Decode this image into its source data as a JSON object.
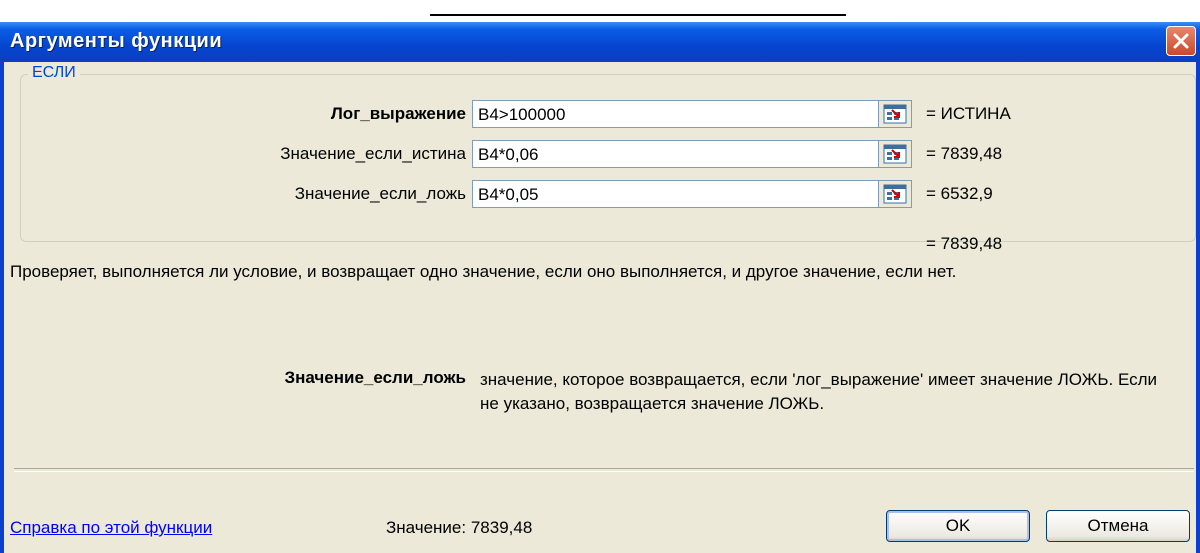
{
  "window": {
    "title": "Аргументы функции"
  },
  "function_group": {
    "name": "ЕСЛИ"
  },
  "arguments": [
    {
      "label": "Лог_выражение",
      "value": "B4>100000",
      "result": "= ИСТИНА",
      "bold": true
    },
    {
      "label": "Значение_если_истина",
      "value": "B4*0,06",
      "result": "= 7839,48",
      "bold": false
    },
    {
      "label": "Значение_если_ложь",
      "value": "B4*0,05",
      "result": "= 6532,9",
      "bold": false
    }
  ],
  "formula_result": "= 7839,48",
  "description": "Проверяет, выполняется ли условие, и возвращает одно значение, если оно выполняется, и другое значение, если нет.",
  "arg_help": {
    "name": "Значение_если_ложь",
    "text": "значение, которое возвращается, если 'лог_выражение' имеет значение ЛОЖЬ. Если не указано, возвращается значение ЛОЖЬ."
  },
  "footer": {
    "help_link": "Справка по этой функции",
    "value_label": "Значение:  7839,48",
    "ok_label": "OK",
    "cancel_label": "Отмена"
  },
  "icons": {
    "close": "close-icon",
    "ref": "collapse-dialog-icon"
  },
  "colors": {
    "titlebar": "#0645d0",
    "dialog_bg": "#ece9d8",
    "link": "#0000ff",
    "group_label": "#0046d5"
  }
}
